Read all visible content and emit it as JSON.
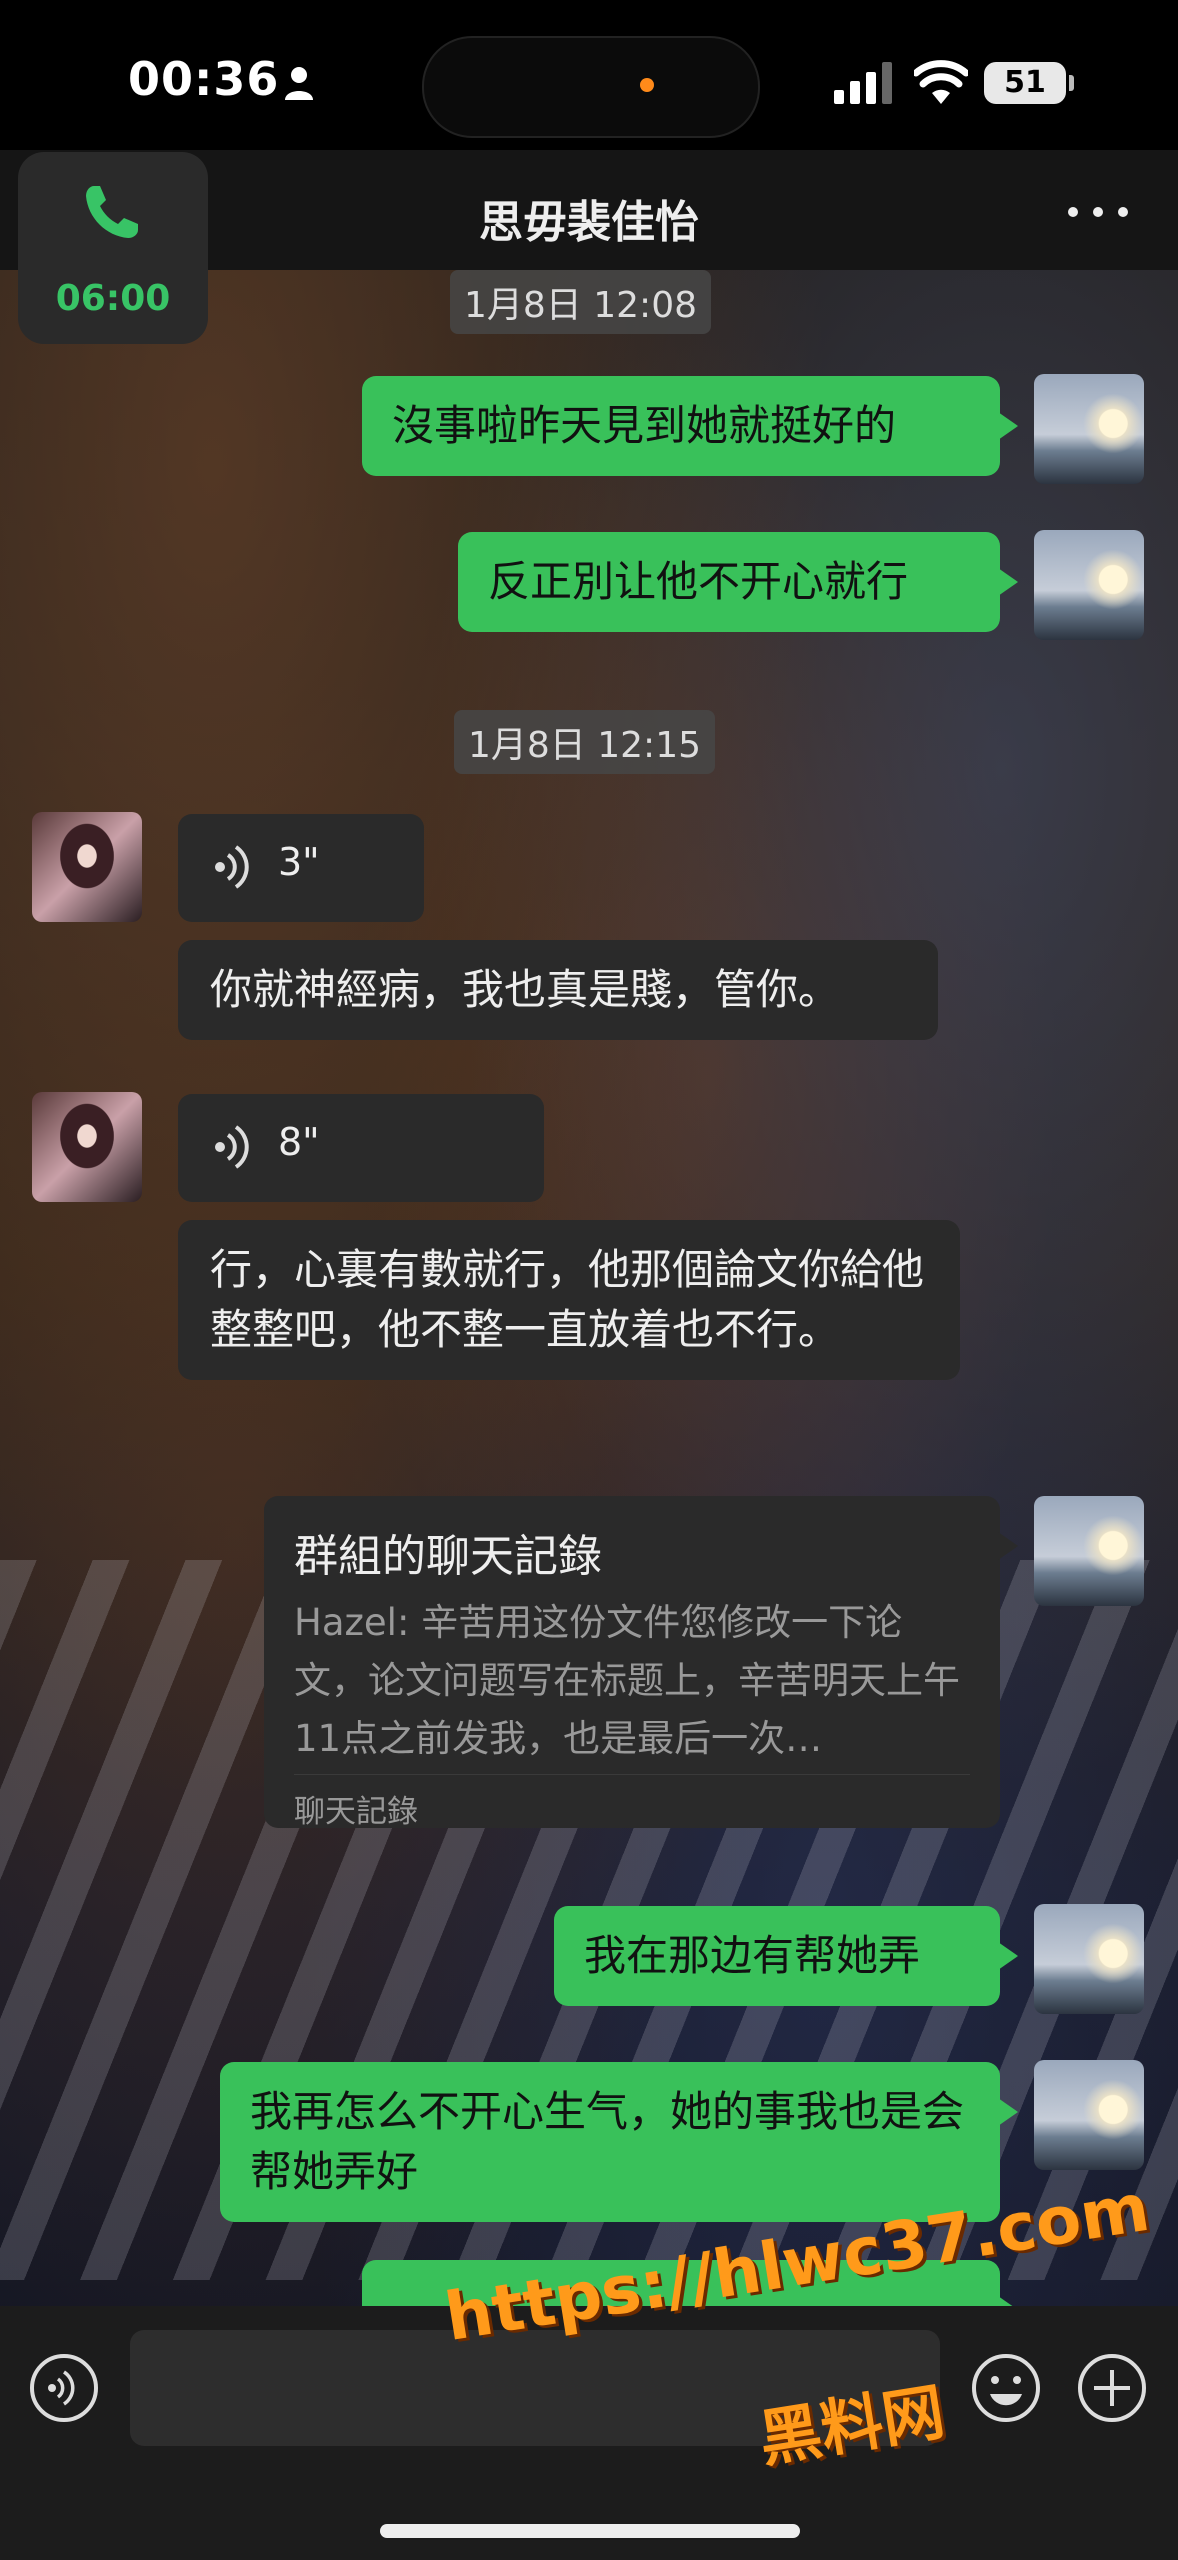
{
  "status_bar": {
    "time": "00:36",
    "battery": "51"
  },
  "header": {
    "title": "思毋裴佳怡"
  },
  "call_widget": {
    "duration": "06:00"
  },
  "messages": {
    "ts1": "1月8日 12:08",
    "out1": "沒事啦昨天見到她就挺好的",
    "out2": "反正別让他不开心就行",
    "ts2": "1月8日 12:15",
    "voice1": "3\"",
    "in1": "你就神經病，我也真是賤，管你。",
    "voice2": "8\"",
    "in2": "行，心裏有數就行，他那個論文你給他整整吧，他不整一直放着也不行。",
    "out3": "我在那边有帮她弄",
    "out4": "我再怎么不开心生气，她的事我也是会帮她弄好"
  },
  "chat_record": {
    "title": "群組的聊天記錄",
    "preview": "Hazel: 辛苦用这份文件您修改一下论文，论文问题写在标题上，辛苦明天上午 11点之前发我，也是最后一次…",
    "label": "聊天記錄"
  },
  "watermark": {
    "url": "https://hlwc37.com",
    "name": "黑料网"
  },
  "colors": {
    "outgoing_bubble": "#39c15a",
    "incoming_bubble": "#2a2a2a",
    "call_green": "#38c466",
    "watermark": "#ff9a1a"
  },
  "icons": [
    "person-icon",
    "signal-icon",
    "wifi-icon",
    "battery-icon",
    "more-icon",
    "phone-icon",
    "voice-wave-icon",
    "emoji-icon",
    "plus-icon"
  ]
}
